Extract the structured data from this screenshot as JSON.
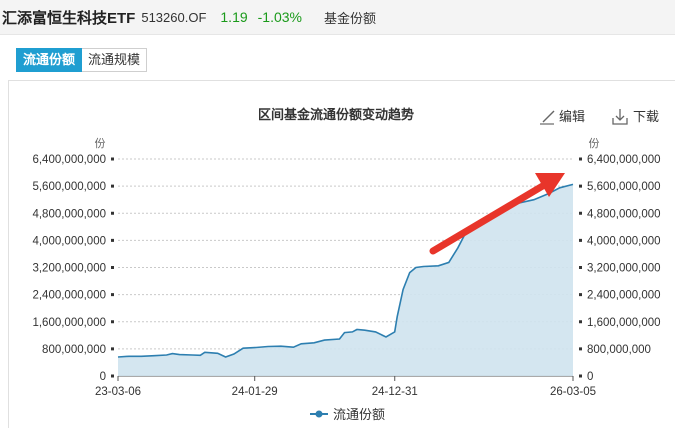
{
  "header": {
    "fund_name": "汇添富恒生科技ETF",
    "fund_code": "513260.OF",
    "price": "1.19",
    "change": "-1.03%",
    "section": "基金份额"
  },
  "tabs": [
    {
      "label": "流通份额",
      "active": true
    },
    {
      "label": "流通规模",
      "active": false
    }
  ],
  "toolbar": {
    "edit_label": "编辑",
    "download_label": "下载"
  },
  "colors": {
    "line": "#2d7fb0",
    "area": "#cfe3ee",
    "tab_active": "#1f9ed1",
    "arrow": "#e8352a",
    "change": "#1a9a1a"
  },
  "chart_data": {
    "type": "area",
    "title": "区间基金流通份额变动趋势",
    "ylabel": "份",
    "ylim": [
      0,
      6400000000
    ],
    "y_ticks": [
      "0",
      "800,000,000",
      "1,600,000,000",
      "2,400,000,000",
      "3,200,000,000",
      "4,000,000,000",
      "4,800,000,000",
      "5,600,000,000",
      "6,400,000,000"
    ],
    "x_ticks": [
      "23-03-06",
      "24-01-29",
      "24-12-31",
      "26-03-05"
    ],
    "grid": true,
    "series": [
      {
        "name": "流通份额",
        "points": [
          [
            "2023-03-06",
            560000000
          ],
          [
            "2023-04-01",
            580000000
          ],
          [
            "2023-05-01",
            580000000
          ],
          [
            "2023-06-01",
            600000000
          ],
          [
            "2023-07-01",
            620000000
          ],
          [
            "2023-07-15",
            660000000
          ],
          [
            "2023-08-01",
            630000000
          ],
          [
            "2023-09-01",
            620000000
          ],
          [
            "2023-09-20",
            610000000
          ],
          [
            "2023-10-01",
            700000000
          ],
          [
            "2023-11-01",
            670000000
          ],
          [
            "2023-11-20",
            560000000
          ],
          [
            "2023-12-10",
            650000000
          ],
          [
            "2024-01-01",
            820000000
          ],
          [
            "2024-02-01",
            840000000
          ],
          [
            "2024-03-01",
            870000000
          ],
          [
            "2024-04-01",
            880000000
          ],
          [
            "2024-05-01",
            850000000
          ],
          [
            "2024-05-20",
            950000000
          ],
          [
            "2024-06-20",
            980000000
          ],
          [
            "2024-07-15",
            1060000000
          ],
          [
            "2024-08-20",
            1090000000
          ],
          [
            "2024-09-01",
            1280000000
          ],
          [
            "2024-09-20",
            1300000000
          ],
          [
            "2024-10-01",
            1370000000
          ],
          [
            "2024-10-20",
            1350000000
          ],
          [
            "2024-11-15",
            1300000000
          ],
          [
            "2024-12-10",
            1150000000
          ],
          [
            "2024-12-31",
            1300000000
          ],
          [
            "2025-01-06",
            1750000000
          ],
          [
            "2025-01-20",
            2550000000
          ],
          [
            "2025-02-05",
            3050000000
          ],
          [
            "2025-02-20",
            3200000000
          ],
          [
            "2025-03-10",
            3230000000
          ],
          [
            "2025-04-15",
            3250000000
          ],
          [
            "2025-05-10",
            3350000000
          ],
          [
            "2025-06-01",
            3780000000
          ],
          [
            "2025-06-25",
            4350000000
          ],
          [
            "2025-07-20",
            4500000000
          ],
          [
            "2025-08-20",
            4700000000
          ],
          [
            "2025-09-25",
            4900000000
          ],
          [
            "2025-10-25",
            5100000000
          ],
          [
            "2025-12-01",
            5200000000
          ],
          [
            "2026-01-05",
            5380000000
          ],
          [
            "2026-02-01",
            5550000000
          ],
          [
            "2026-03-05",
            5650000000
          ]
        ]
      }
    ]
  }
}
